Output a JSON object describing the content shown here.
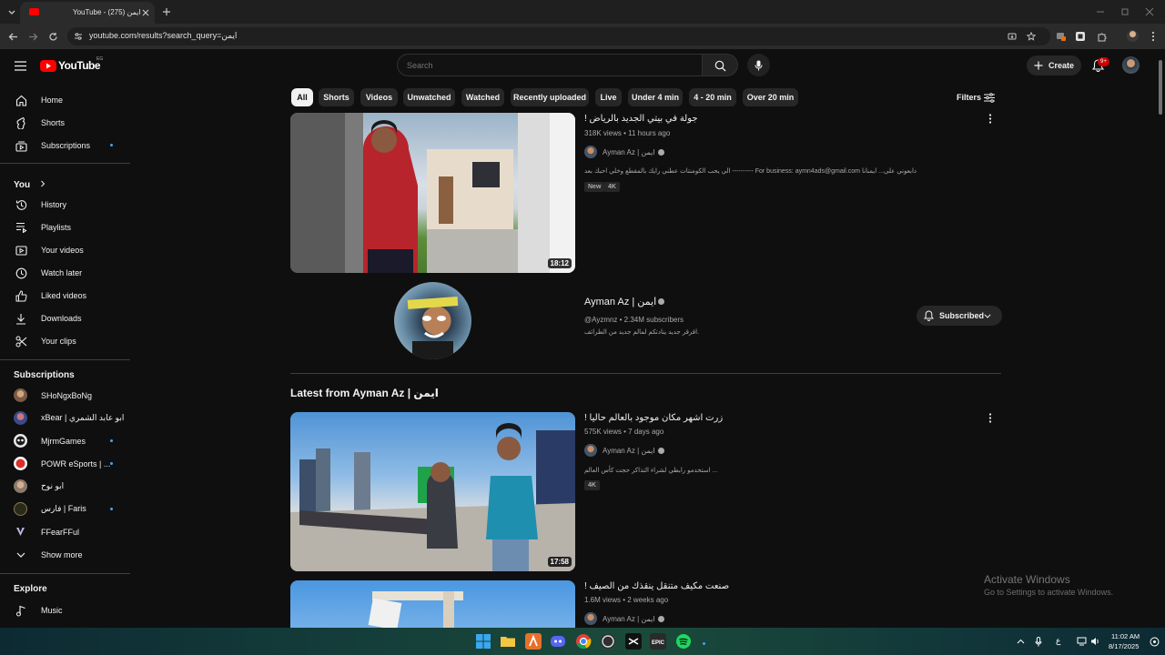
{
  "browser": {
    "tab_title": "YouTube - ايمن (275)",
    "url": "youtube.com/results?search_query=ايمن"
  },
  "header": {
    "logo_text": "YouTube",
    "country_code": "EG",
    "search_placeholder": "Search",
    "create_label": "Create",
    "notifications_badge": "9+"
  },
  "sidebar": {
    "main": [
      {
        "label": "Home",
        "icon": "home-icon"
      },
      {
        "label": "Shorts",
        "icon": "shorts-icon"
      },
      {
        "label": "Subscriptions",
        "icon": "subscriptions-icon"
      }
    ],
    "you_title": "You",
    "you_items": [
      {
        "label": "History",
        "icon": "history-icon"
      },
      {
        "label": "Playlists",
        "icon": "playlists-icon"
      },
      {
        "label": "Your videos",
        "icon": "your-videos-icon"
      },
      {
        "label": "Watch later",
        "icon": "watch-later-icon"
      },
      {
        "label": "Liked videos",
        "icon": "liked-icon"
      },
      {
        "label": "Downloads",
        "icon": "download-icon"
      },
      {
        "label": "Your clips",
        "icon": "clips-icon"
      }
    ],
    "subs_title": "Subscriptions",
    "subscriptions": [
      {
        "label": "SHoNgxBoNg",
        "dot": false,
        "color": "#7a5a48"
      },
      {
        "label": "xBear | ابو عابد الشمري",
        "dot": false,
        "color": "#3a4a8a"
      },
      {
        "label": "MjrmGames",
        "dot": true,
        "color": "#e8e8e8"
      },
      {
        "label": "POWR eSports | ...",
        "dot": true,
        "color": "#d8312c"
      },
      {
        "label": "ابو نوح",
        "dot": false,
        "color": "#8a7a6a"
      },
      {
        "label": "فارس | Faris",
        "dot": true,
        "color": "#3a3a2a"
      },
      {
        "label": "FFearFFul",
        "dot": false,
        "color": "#0f0f0f"
      }
    ],
    "show_more": "Show more",
    "explore_title": "Explore",
    "explore_items": [
      {
        "label": "Music",
        "icon": "music-icon"
      }
    ]
  },
  "filters": {
    "chips": [
      "All",
      "Shorts",
      "Videos",
      "Unwatched",
      "Watched",
      "Recently uploaded",
      "Live",
      "Under 4 min",
      "4 - 20 min",
      "Over 20 min"
    ],
    "filters_label": "Filters"
  },
  "results": {
    "video1": {
      "title": "جولة في بيتي الجديد بالرياض !",
      "meta": "318K views • 11 hours ago",
      "channel": "Ayman Az | ايمن",
      "description": "الي يحب الكومنتات عطني رايك بالمقطع وخلي احبك بعد ---------- For business: aymn4ads@gmail.com دابعوني على... ايمنانا",
      "badges": [
        "New",
        "4K"
      ],
      "duration": "18:12"
    },
    "channel": {
      "name": "Ayman Az | ايمن",
      "handle_subs": "@Ayzmnz • 2.34M subscribers",
      "description": "اقرقر جديد ينادتكم لمالم جديد من الطرائف.",
      "subscribed_label": "Subscribed"
    },
    "latest_title": "Latest from Ayman Az | ايمن",
    "video2": {
      "title": "زرت اشهر مكان موجود بالعالم حاليا !",
      "meta": "575K views • 7 days ago",
      "channel": "Ayman Az | ايمن",
      "description": "استخدمو رابطي لشراء التذاكر حجت كأس العالم ...",
      "badges": [
        "4K"
      ],
      "duration": "17:58"
    },
    "video3": {
      "title": "صنعت مكيف متنقل ينقذك من الصيف !",
      "meta": "1.6M views • 2 weeks ago",
      "channel": "Ayman Az | ايمن"
    }
  },
  "windows": {
    "activate_title": "Activate Windows",
    "activate_sub": "Go to Settings to activate Windows.",
    "time": "11:02 AM",
    "date": "8/17/2025",
    "lang": "ع"
  },
  "colors": {
    "youtube_red": "#ff0000",
    "accent_blue": "#3ea6ff",
    "bg": "#0f0f0f"
  }
}
